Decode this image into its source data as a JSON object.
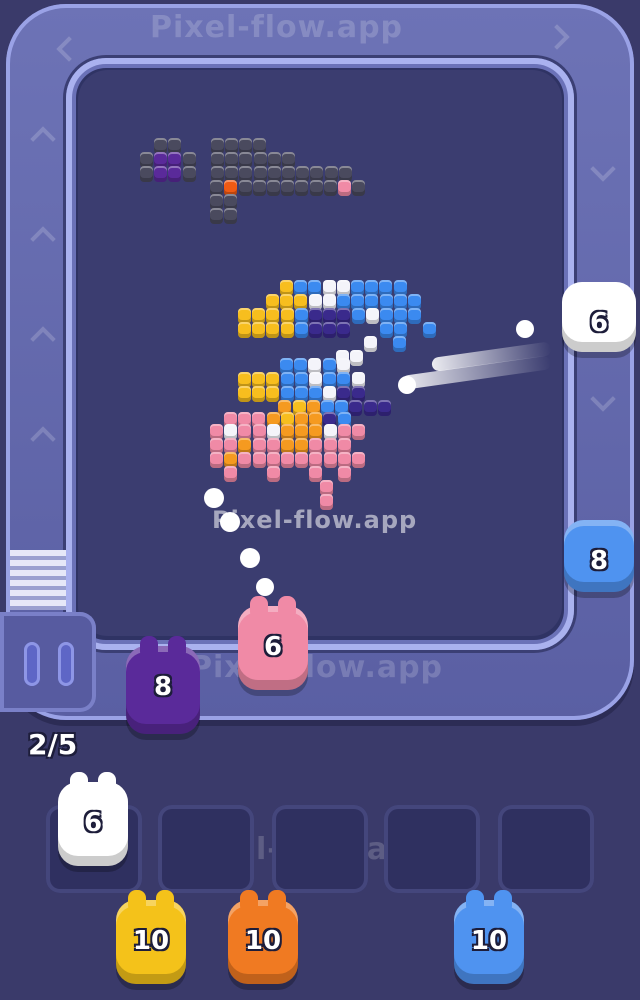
{
  "watermark": "Pixel-flow.app",
  "queue_counter": "2/5",
  "shooters": {
    "right_top": {
      "value": "6",
      "color": "#ffffff"
    },
    "right_mid": {
      "value": "8",
      "color": "#4f93f0"
    },
    "firing_pink": {
      "value": "6",
      "color": "#f08aa6"
    },
    "purple": {
      "value": "8",
      "color": "#5a2a9a"
    },
    "slot_white": {
      "value": "6",
      "color": "#ffffff"
    },
    "bottom_yellow": {
      "value": "10",
      "color": "#f4c21a"
    },
    "bottom_orange": {
      "value": "10",
      "color": "#f07a22"
    },
    "bottom_blue": {
      "value": "10",
      "color": "#4f93f0"
    }
  },
  "colors": {
    "gray": "#4a4a5e",
    "purple": "#5a2a9a",
    "orange": "#f05a14",
    "pink": "#f08aa6",
    "white": "#f4f4fa",
    "blue": "#3b8af0",
    "yellow": "#f7be1e",
    "amber": "#f59a20",
    "indigo": "#3a2a8c"
  }
}
